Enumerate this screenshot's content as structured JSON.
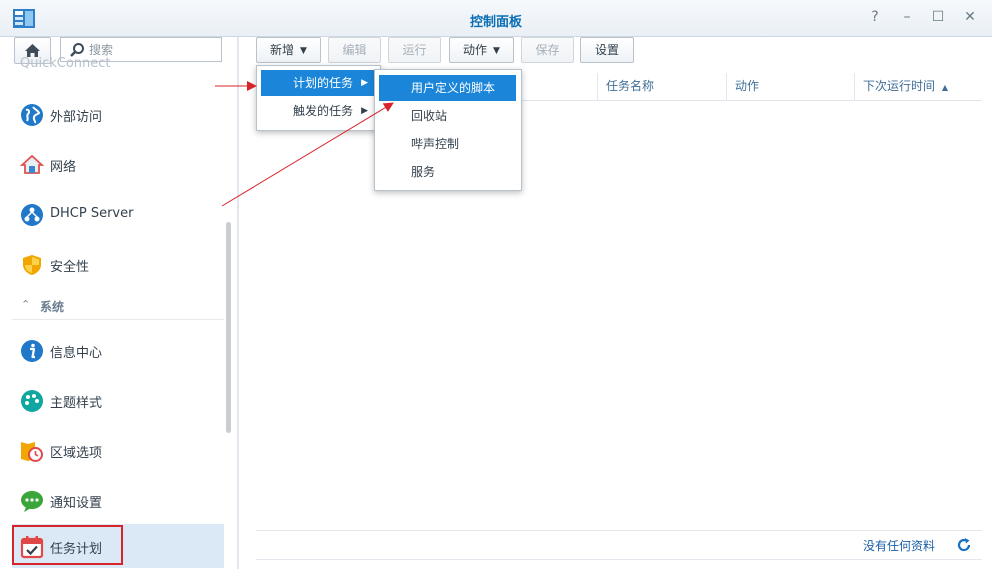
{
  "window": {
    "title": "控制面板",
    "controls": {
      "help": "?",
      "minimize": "–",
      "maximize": "☐",
      "close": "✕"
    }
  },
  "sidebar": {
    "search_placeholder": "搜索",
    "partial_item": "QuickConnect",
    "items_top": [
      {
        "label": "外部访问",
        "icon": "globe-icon"
      },
      {
        "label": "网络",
        "icon": "house-network-icon"
      },
      {
        "label": "DHCP Server",
        "icon": "dhcp-icon"
      },
      {
        "label": "安全性",
        "icon": "shield-icon"
      }
    ],
    "section": "系统",
    "items_system": [
      {
        "label": "信息中心",
        "icon": "info-icon"
      },
      {
        "label": "主题样式",
        "icon": "palette-icon"
      },
      {
        "label": "区域选项",
        "icon": "region-clock-icon"
      },
      {
        "label": "通知设置",
        "icon": "chat-bubble-icon"
      },
      {
        "label": "任务计划",
        "icon": "calendar-check-icon",
        "selected": true
      }
    ]
  },
  "toolbar": {
    "create": "新增",
    "edit": "编辑",
    "run": "运行",
    "action": "动作",
    "save": "保存",
    "settings": "设置"
  },
  "grid": {
    "columns": [
      "任务名称",
      "动作",
      "下次运行时间"
    ],
    "sort_indicator": "▲",
    "empty_text": "没有任何资料"
  },
  "create_menu": {
    "items": [
      "计划的任务",
      "触发的任务"
    ],
    "active_index": 0
  },
  "submenu": {
    "items": [
      "用户定义的脚本",
      "回收站",
      "哔声控制",
      "服务"
    ],
    "active_index": 0
  },
  "colors": {
    "accent": "#1a85d9",
    "title": "#0a6eb5",
    "highlight": "#d7242c",
    "selected_bg": "#dbe9f6"
  }
}
